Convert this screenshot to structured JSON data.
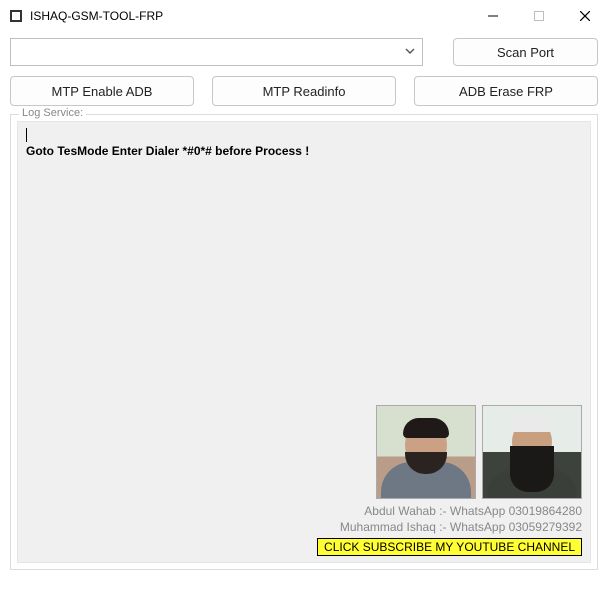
{
  "window": {
    "title": "ISHAQ-GSM-TOOL-FRP"
  },
  "toolbar": {
    "scan_port": "Scan Port",
    "mtp_enable_adb": "MTP Enable ADB",
    "mtp_readinfo": "MTP Readinfo",
    "adb_erase_frp": "ADB Erase FRP"
  },
  "log": {
    "legend": "Log Service:",
    "message": "Goto TesMode Enter Dialer *#0*# before Process !"
  },
  "contacts": {
    "line1": "Abdul Wahab :- WhatsApp 03019864280",
    "line2": "Muhammad Ishaq :- WhatsApp 03059279392",
    "subscribe": "CLICK SUBSCRIBE MY YOUTUBE CHANNEL"
  }
}
